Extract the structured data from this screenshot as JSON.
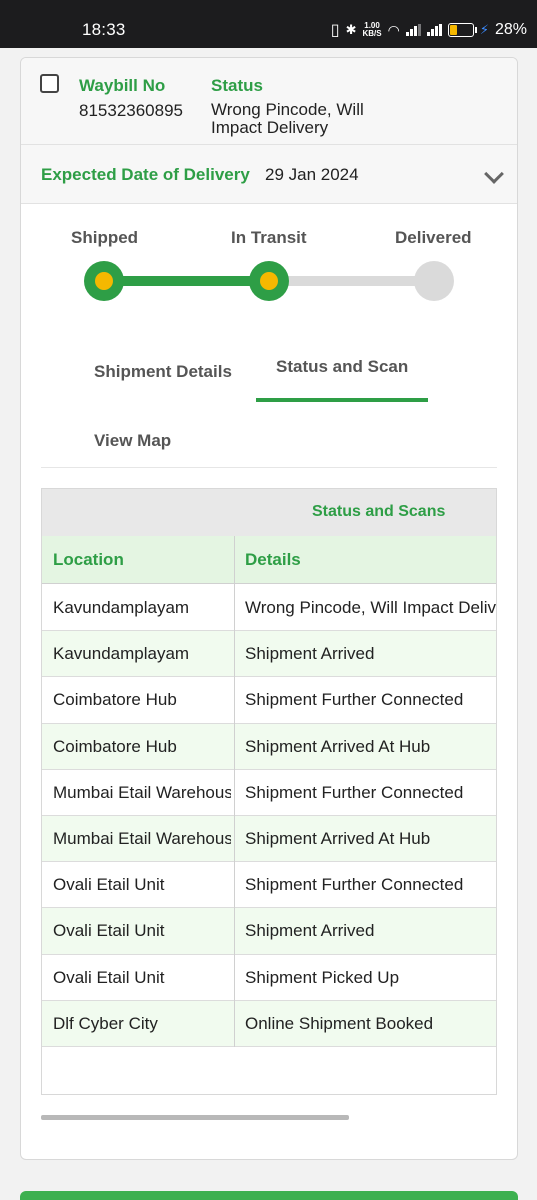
{
  "statusbar": {
    "time": "18:33",
    "speed_value": "1.00",
    "speed_unit": "KB/S",
    "battery": "28%"
  },
  "shipment": {
    "waybill_label": "Waybill No",
    "waybill_no": "81532360895",
    "status_label": "Status",
    "status_value": "Wrong Pincode, Will Impact Delivery",
    "edd_label": "Expected Date of Delivery",
    "edd_value": "29 Jan 2024"
  },
  "progress": {
    "stages": [
      "Shipped",
      "In Transit",
      "Delivered"
    ],
    "completed_stages": 2
  },
  "tabs": {
    "shipment_details": "Shipment Details",
    "status_and_scan": "Status and Scan",
    "view_map": "View Map",
    "active": "Status and Scan"
  },
  "scans": {
    "title": "Status and Scans",
    "columns": [
      "Location",
      "Details"
    ],
    "rows": [
      {
        "location": "Kavundamplayam",
        "details": "Wrong Pincode, Will Impact Delivery"
      },
      {
        "location": "Kavundamplayam",
        "details": "Shipment Arrived"
      },
      {
        "location": "Coimbatore Hub",
        "details": "Shipment Further Connected"
      },
      {
        "location": "Coimbatore Hub",
        "details": "Shipment Arrived At Hub"
      },
      {
        "location": "Mumbai Etail Warehouse",
        "details": "Shipment Further Connected"
      },
      {
        "location": "Mumbai Etail Warehouse",
        "details": "Shipment Arrived At Hub"
      },
      {
        "location": "Ovali Etail Unit",
        "details": "Shipment Further Connected"
      },
      {
        "location": "Ovali Etail Unit",
        "details": "Shipment Arrived"
      },
      {
        "location": "Ovali Etail Unit",
        "details": "Shipment Picked Up"
      },
      {
        "location": "Dlf Cyber City",
        "details": "Online Shipment Booked"
      }
    ]
  },
  "colors": {
    "accent": "#2e9e46",
    "progress_dot": "#f5b800",
    "row_alt": "#f1fbef"
  }
}
